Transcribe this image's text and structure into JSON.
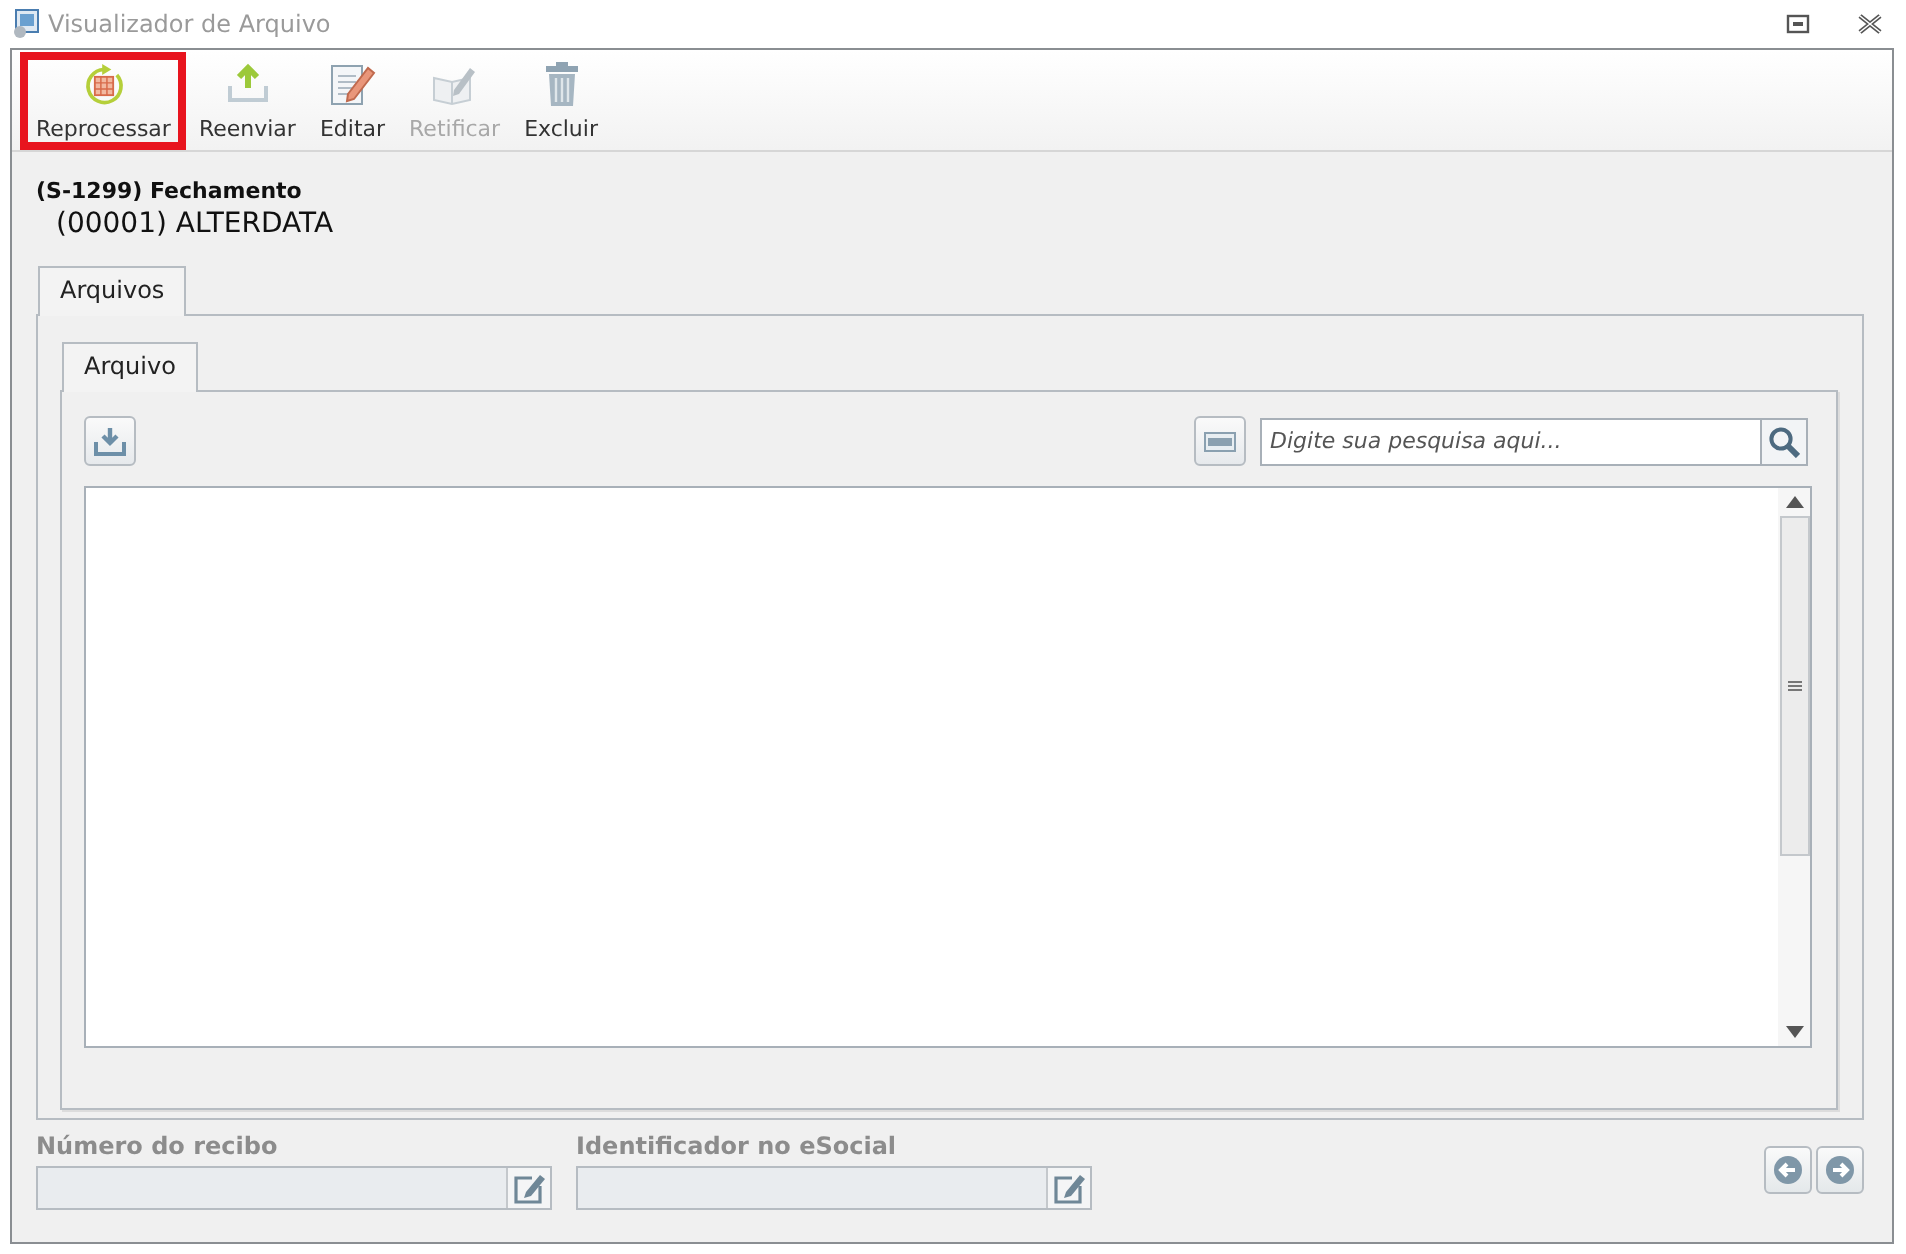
{
  "window": {
    "title": "Visualizador de Arquivo"
  },
  "toolbar": [
    {
      "kind": "reprocess",
      "label": "Reprocessar",
      "selected": true,
      "disabled": false
    },
    {
      "kind": "upload",
      "label": "Reenviar",
      "selected": false,
      "disabled": false
    },
    {
      "kind": "edit",
      "label": "Editar",
      "selected": false,
      "disabled": false
    },
    {
      "kind": "rectify",
      "label": "Retificar",
      "selected": false,
      "disabled": true
    },
    {
      "kind": "delete",
      "label": "Excluir",
      "selected": false,
      "disabled": false
    }
  ],
  "event": {
    "title": "(S-1299) Fechamento",
    "company": "(00001) ALTERDATA"
  },
  "outer_tabs": [
    {
      "label": "Arquivos",
      "selected": true
    }
  ],
  "inner_tabs": [
    {
      "label": "Arquivo",
      "selected": true
    }
  ],
  "search": {
    "placeholder": "Digite sua pesquisa aqui..."
  },
  "fields": [
    {
      "label": "Número do recibo"
    },
    {
      "label": "Identificador no eSocial"
    }
  ]
}
